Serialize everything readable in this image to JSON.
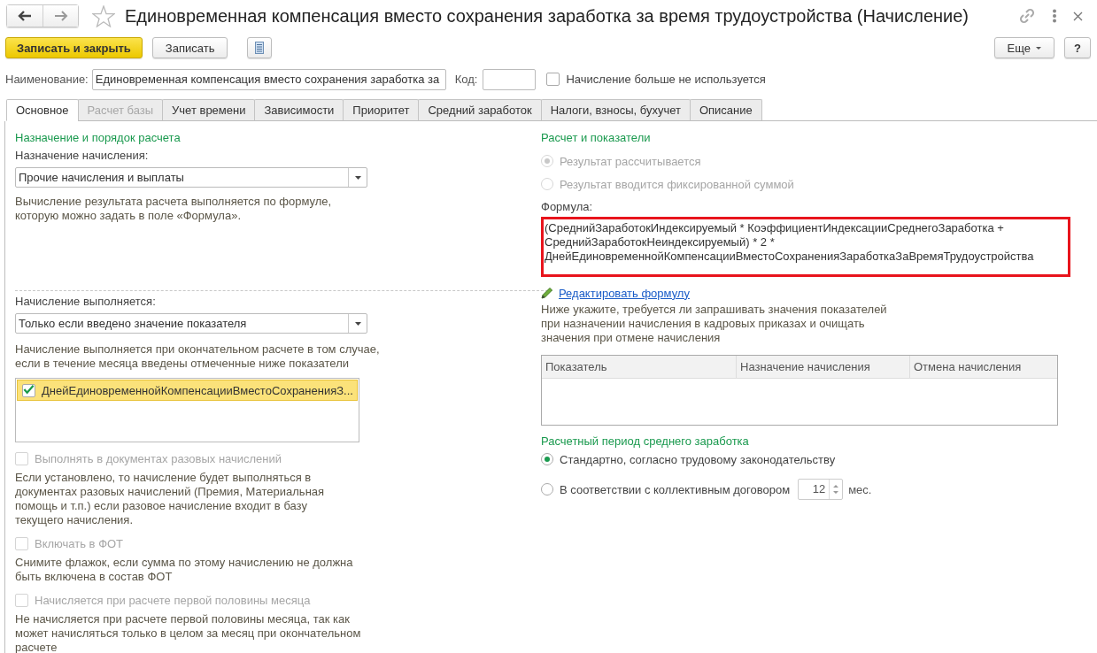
{
  "window": {
    "title": "Единовременная компенсация вместо сохранения заработка за время трудоустройства (Начисление)"
  },
  "toolbar": {
    "buttons": [
      {
        "kind": "primary",
        "label": "Записать и закрыть"
      },
      {
        "kind": "plain",
        "label": "Записать"
      },
      {
        "kind": "list"
      }
    ],
    "more": "Еще",
    "help": "?"
  },
  "header_fields": {
    "name_label": "Наименование:",
    "name_value": "Единовременная компенсация вместо сохранения заработка за",
    "code_label": "Код:",
    "unused": {
      "label": "Начисление больше не используется",
      "checked": false
    }
  },
  "tabs": [
    {
      "label": "Основное",
      "selected": true,
      "disabled": false
    },
    {
      "label": "Расчет базы",
      "selected": false,
      "disabled": true
    },
    {
      "label": "Учет времени",
      "selected": false,
      "disabled": false
    },
    {
      "label": "Зависимости",
      "selected": false,
      "disabled": false
    },
    {
      "label": "Приоритет",
      "selected": false,
      "disabled": false
    },
    {
      "label": "Средний заработок",
      "selected": false,
      "disabled": false
    },
    {
      "label": "Налоги, взносы, бухучет",
      "selected": false,
      "disabled": false
    },
    {
      "label": "Описание",
      "selected": false,
      "disabled": false
    }
  ],
  "left": {
    "section_title": "Назначение и порядок расчета",
    "purpose": {
      "label": "Назначение начисления:",
      "value": "Прочие начисления и выплаты"
    },
    "purpose_hint": "Вычисление результата расчета выполняется по формуле,\nкоторую можно задать в поле «Формула».",
    "execution": {
      "label": "Начисление выполняется:",
      "value": "Только если введено значение показателя"
    },
    "execution_hint": "Начисление выполняется при окончательном расчете в том случае,\nесли в течение месяца введены отмеченные ниже показатели",
    "indicators": [
      {
        "label": "ДнейЕдиновременнойКомпенсацииВместоСохраненияЗ...",
        "checked": true,
        "selected": true
      }
    ],
    "options": [
      {
        "label": "Выполнять в документах разовых начислений",
        "checked": false,
        "disabled": true,
        "hint": "Если установлено, то начисление будет выполняться в\nдокументах разовых начислений (Премия, Материальная\nпомощь и т.п.) если разовое начисление входит в базу\nтекущего начисления."
      },
      {
        "label": "Включать в ФОТ",
        "checked": false,
        "disabled": true,
        "hint": "Снимите флажок, если сумма по этому начислению не должна\nбыть включена в состав ФОТ"
      },
      {
        "label": "Начисляется при расчете первой половины месяца",
        "checked": false,
        "disabled": true,
        "hint": "Не начисляется при расчете первой половины месяца, так как\nможет начисляться только в целом за месяц при окончательном\nрасчете"
      }
    ]
  },
  "right": {
    "section_title": "Расчет и показатели",
    "result_modes": [
      {
        "label": "Результат рассчитывается",
        "selected": true,
        "disabled": true
      },
      {
        "label": "Результат вводится фиксированной суммой",
        "selected": false,
        "disabled": true
      }
    ],
    "formula": {
      "label": "Формула:",
      "highlighted": true,
      "lines": [
        "(СреднийЗаработокИндексируемый * КоэффициентИндексацииСреднегоЗаработка +",
        "СреднийЗаработокНеиндексируемый) * 2 *",
        "ДнейЕдиновременнойКомпенсацииВместоСохраненияЗаработкаЗаВремяТрудоустройства"
      ]
    },
    "edit_link": "Редактировать формулу",
    "indicators_hint": "Ниже укажите, требуется ли запрашивать значения показателей\nпри назначении начисления в кадровых приказах и очищать\nзначения при отмене начисления",
    "table": {
      "columns": [
        "Показатель",
        "Назначение начисления",
        "Отмена начисления"
      ]
    },
    "period_title": "Расчетный период среднего заработка",
    "period_options": [
      {
        "kind": "plain",
        "label": "Стандартно, согласно трудовому законодательству",
        "selected": true
      },
      {
        "kind": "months",
        "label": "В соответствии с коллективным договором",
        "selected": false,
        "months": "12",
        "unit": "мес."
      }
    ]
  }
}
